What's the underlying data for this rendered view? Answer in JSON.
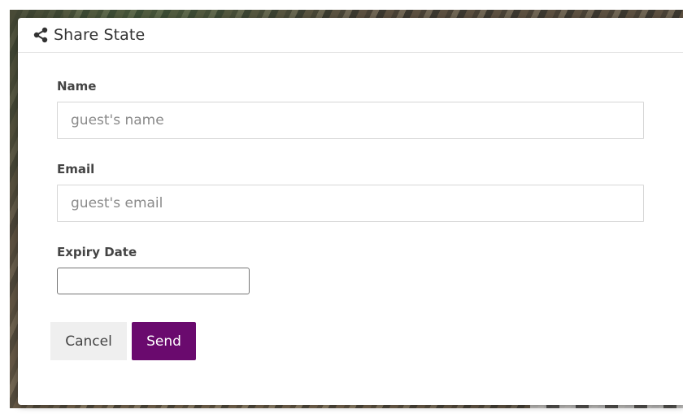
{
  "dialog": {
    "title": "Share State",
    "icon": "share-icon"
  },
  "form": {
    "name": {
      "label": "Name",
      "placeholder": "guest's name",
      "value": ""
    },
    "email": {
      "label": "Email",
      "placeholder": "guest's email",
      "value": ""
    },
    "expiry": {
      "label": "Expiry Date",
      "value": ""
    }
  },
  "actions": {
    "cancel_label": "Cancel",
    "send_label": "Send"
  },
  "colors": {
    "accent": "#6a0a6e",
    "cancel_bg": "#efefef"
  }
}
